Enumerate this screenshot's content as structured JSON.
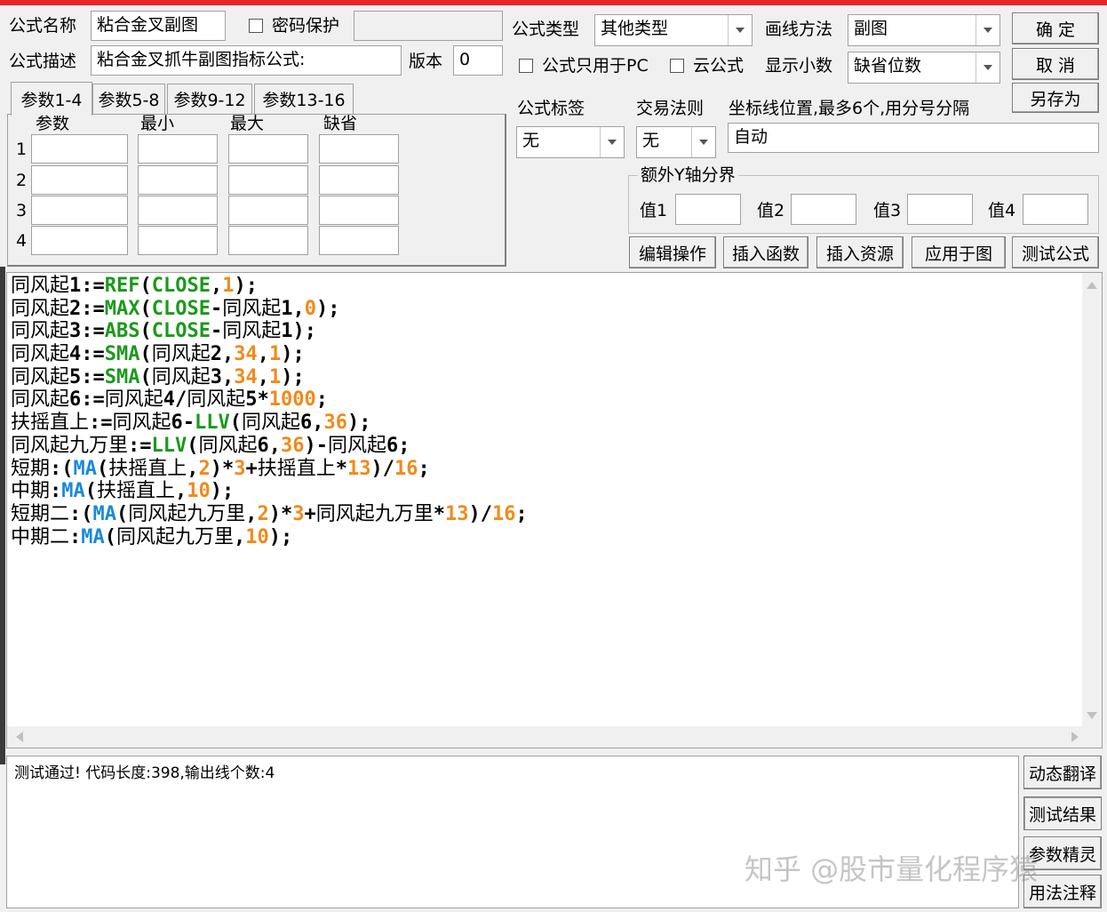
{
  "top": {
    "formula_name_label": "公式名称",
    "formula_name_value": "粘合金叉副图",
    "password_label": "密码保护",
    "formula_desc_label": "公式描述",
    "formula_desc_value": "粘合金叉抓牛副图指标公式:",
    "version_label": "版本",
    "version_value": "0",
    "formula_type_label": "公式类型",
    "formula_type_value": "其他类型",
    "draw_method_label": "画线方法",
    "draw_method_value": "副图",
    "pc_only_label": "公式只用于PC",
    "cloud_label": "云公式",
    "decimals_label": "显示小数",
    "decimals_value": "缺省位数",
    "ok_button": "确  定",
    "cancel_button": "取  消",
    "save_as_button": "另存为"
  },
  "params": {
    "tabs": [
      "参数1-4",
      "参数5-8",
      "参数9-12",
      "参数13-16"
    ],
    "headers": [
      "参数",
      "最小",
      "最大",
      "缺省"
    ],
    "rows": [
      "1",
      "2",
      "3",
      "4"
    ]
  },
  "right": {
    "tag_label": "公式标签",
    "tag_value": "无",
    "trade_label": "交易法则",
    "trade_value": "无",
    "coord_label": "坐标线位置,最多6个,用分号分隔",
    "coord_value": "自动",
    "y_axis_group": "额外Y轴分界",
    "val1": "值1",
    "val2": "值2",
    "val3": "值3",
    "val4": "值4",
    "actions": [
      "编辑操作",
      "插入函数",
      "插入资源",
      "应用于图",
      "测试公式"
    ]
  },
  "code_lines": [
    [
      [
        "v",
        "同风起"
      ],
      [
        "o",
        "1:="
      ],
      [
        "f",
        "REF"
      ],
      [
        "o",
        "("
      ],
      [
        "f",
        "CLOSE"
      ],
      [
        "o",
        ","
      ],
      [
        "n",
        "1"
      ],
      [
        "o",
        ");"
      ]
    ],
    [
      [
        "v",
        "同风起"
      ],
      [
        "o",
        "2:="
      ],
      [
        "f",
        "MAX"
      ],
      [
        "o",
        "("
      ],
      [
        "f",
        "CLOSE"
      ],
      [
        "o",
        "-"
      ],
      [
        "v",
        "同风起"
      ],
      [
        "o",
        "1,"
      ],
      [
        "n",
        "0"
      ],
      [
        "o",
        ");"
      ]
    ],
    [
      [
        "v",
        "同风起"
      ],
      [
        "o",
        "3:="
      ],
      [
        "f",
        "ABS"
      ],
      [
        "o",
        "("
      ],
      [
        "f",
        "CLOSE"
      ],
      [
        "o",
        "-"
      ],
      [
        "v",
        "同风起"
      ],
      [
        "o",
        "1);"
      ]
    ],
    [
      [
        "v",
        "同风起"
      ],
      [
        "o",
        "4:="
      ],
      [
        "f",
        "SMA"
      ],
      [
        "o",
        "("
      ],
      [
        "v",
        "同风起"
      ],
      [
        "o",
        "2,"
      ],
      [
        "n",
        "34"
      ],
      [
        "o",
        ","
      ],
      [
        "n",
        "1"
      ],
      [
        "o",
        ");"
      ]
    ],
    [
      [
        "v",
        "同风起"
      ],
      [
        "o",
        "5:="
      ],
      [
        "f",
        "SMA"
      ],
      [
        "o",
        "("
      ],
      [
        "v",
        "同风起"
      ],
      [
        "o",
        "3,"
      ],
      [
        "n",
        "34"
      ],
      [
        "o",
        ","
      ],
      [
        "n",
        "1"
      ],
      [
        "o",
        ");"
      ]
    ],
    [
      [
        "v",
        "同风起"
      ],
      [
        "o",
        "6:="
      ],
      [
        "v",
        "同风起"
      ],
      [
        "o",
        "4/"
      ],
      [
        "v",
        "同风起"
      ],
      [
        "o",
        "5*"
      ],
      [
        "n",
        "1000"
      ],
      [
        "o",
        ";"
      ]
    ],
    [
      [
        "v",
        "扶摇直上"
      ],
      [
        "o",
        ":="
      ],
      [
        "v",
        "同风起"
      ],
      [
        "o",
        "6-"
      ],
      [
        "f",
        "LLV"
      ],
      [
        "o",
        "("
      ],
      [
        "v",
        "同风起"
      ],
      [
        "o",
        "6,"
      ],
      [
        "n",
        "36"
      ],
      [
        "o",
        ");"
      ]
    ],
    [
      [
        "v",
        "同风起九万里"
      ],
      [
        "o",
        ":="
      ],
      [
        "f",
        "LLV"
      ],
      [
        "o",
        "("
      ],
      [
        "v",
        "同风起"
      ],
      [
        "o",
        "6,"
      ],
      [
        "n",
        "36"
      ],
      [
        "o",
        ")-"
      ],
      [
        "v",
        "同风起"
      ],
      [
        "o",
        "6;"
      ]
    ],
    [
      [
        "v",
        "短期"
      ],
      [
        "o",
        ":("
      ],
      [
        "m",
        "MA"
      ],
      [
        "o",
        "("
      ],
      [
        "v",
        "扶摇直上"
      ],
      [
        "o",
        ","
      ],
      [
        "n",
        "2"
      ],
      [
        "o",
        ")*"
      ],
      [
        "n",
        "3"
      ],
      [
        "o",
        "+"
      ],
      [
        "v",
        "扶摇直上"
      ],
      [
        "o",
        "*"
      ],
      [
        "n",
        "13"
      ],
      [
        "o",
        ")/"
      ],
      [
        "n",
        "16"
      ],
      [
        "o",
        ";"
      ]
    ],
    [
      [
        "v",
        "中期"
      ],
      [
        "o",
        ":"
      ],
      [
        "m",
        "MA"
      ],
      [
        "o",
        "("
      ],
      [
        "v",
        "扶摇直上"
      ],
      [
        "o",
        ","
      ],
      [
        "n",
        "10"
      ],
      [
        "o",
        ");"
      ]
    ],
    [
      [
        "v",
        "短期二"
      ],
      [
        "o",
        ":("
      ],
      [
        "m",
        "MA"
      ],
      [
        "o",
        "("
      ],
      [
        "v",
        "同风起九万里"
      ],
      [
        "o",
        ","
      ],
      [
        "n",
        "2"
      ],
      [
        "o",
        ")*"
      ],
      [
        "n",
        "3"
      ],
      [
        "o",
        "+"
      ],
      [
        "v",
        "同风起九万里"
      ],
      [
        "o",
        "*"
      ],
      [
        "n",
        "13"
      ],
      [
        "o",
        ")/"
      ],
      [
        "n",
        "16"
      ],
      [
        "o",
        ";"
      ]
    ],
    [
      [
        "v",
        "中期二"
      ],
      [
        "o",
        ":"
      ],
      [
        "m",
        "MA"
      ],
      [
        "o",
        "("
      ],
      [
        "v",
        "同风起九万里"
      ],
      [
        "o",
        ","
      ],
      [
        "n",
        "10"
      ],
      [
        "o",
        ");"
      ]
    ]
  ],
  "status": {
    "message": "测试通过! 代码长度:398,输出线个数:4",
    "side_buttons": [
      "动态翻译",
      "测试结果",
      "参数精灵",
      "用法注释"
    ],
    "watermark": "知乎 @股市量化程序猿"
  },
  "colors": {
    "func": "#1a9a1a",
    "ma": "#1a8ad8",
    "number": "#f08a1a",
    "titlebar": "#e8232a"
  }
}
